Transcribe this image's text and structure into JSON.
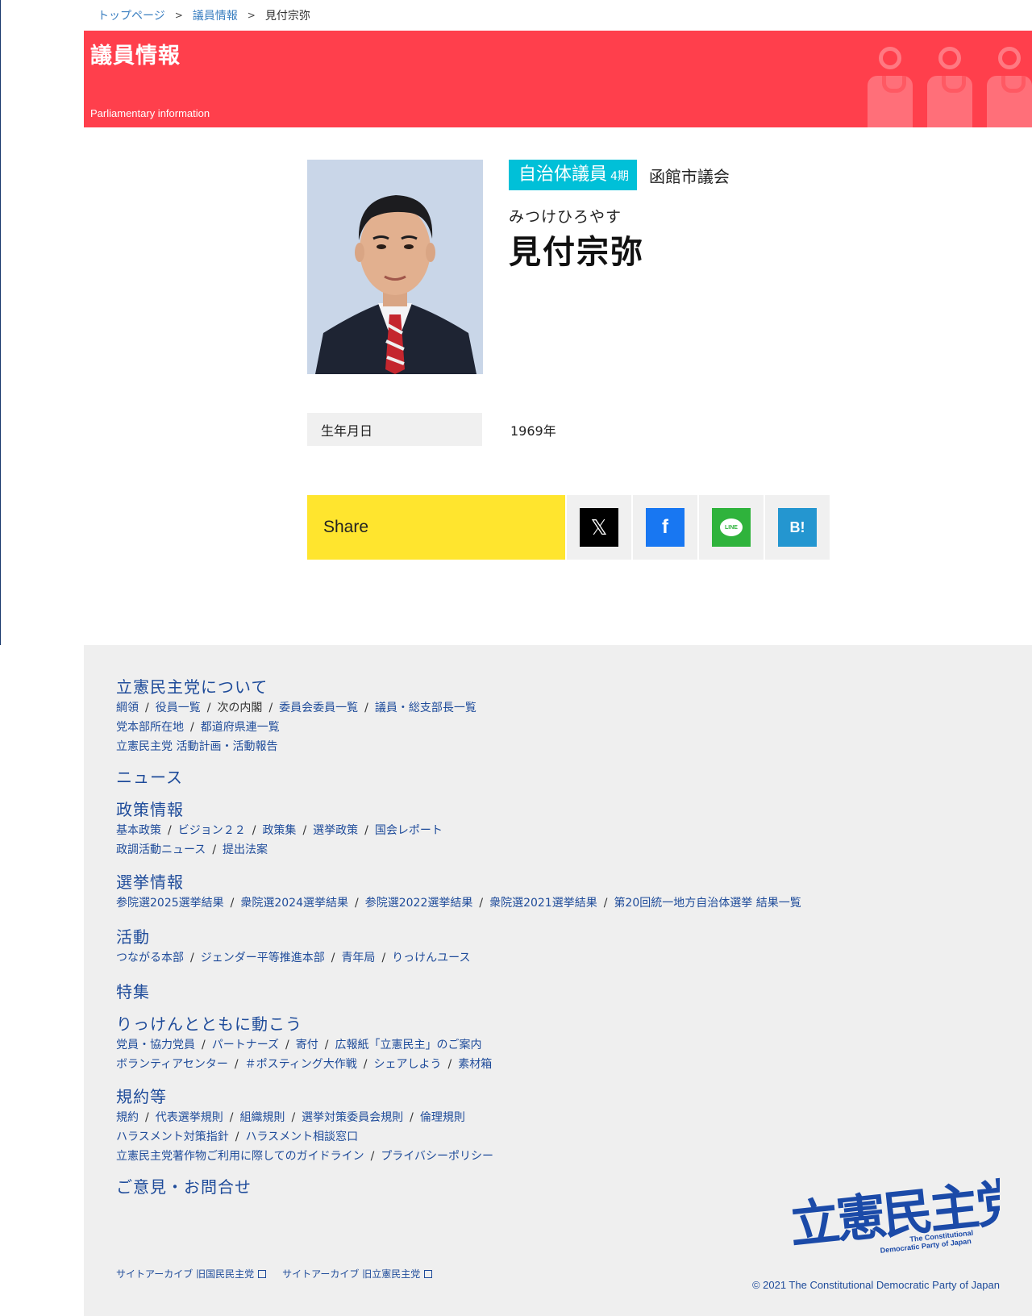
{
  "breadcrumb": [
    {
      "label": "トップページ"
    },
    {
      "label": "議員情報"
    },
    {
      "current": "見付宗弥"
    }
  ],
  "hero": {
    "title": "議員情報",
    "subtitle": "Parliamentary information"
  },
  "profile": {
    "badge_label": "自治体議員",
    "badge_term": "4期",
    "assembly": "函館市議会",
    "kana": "みつけひろやす",
    "name": "見付宗弥"
  },
  "info": {
    "birth_label": "生年月日",
    "birth_value": "1969年"
  },
  "share": {
    "label": "Share",
    "buttons": [
      "x-icon",
      "facebook-icon",
      "line-icon",
      "hatena-bookmark-icon"
    ],
    "x_glyph": "𝕏",
    "fb_glyph": "f",
    "line_glyph": "LINE",
    "hb_glyph": "B!"
  },
  "colors": {
    "hero": "#ff3f4c",
    "badge": "#00c0d8",
    "share": "#ffe52e",
    "footer_link": "#1e4b9a"
  },
  "footer": {
    "about": {
      "title": "立憲民主党について",
      "line1": [
        "綱領",
        "役員一覧",
        "次の内閣",
        "委員会委員一覧",
        "議員・総支部長一覧"
      ],
      "line2": [
        "党本部所在地",
        "都道府県連一覧"
      ],
      "line3": [
        "立憲民主党 活動計画・活動報告"
      ]
    },
    "news": {
      "title": "ニュース"
    },
    "policy": {
      "title": "政策情報",
      "line1": [
        "基本政策",
        "ビジョン２２",
        "政策集",
        "選挙政策",
        "国会レポート"
      ],
      "line2": [
        "政調活動ニュース",
        "提出法案"
      ]
    },
    "election": {
      "title": "選挙情報",
      "line1": [
        "参院選2025選挙結果",
        "衆院選2024選挙結果",
        "参院選2022選挙結果",
        "衆院選2021選挙結果",
        "第20回統一地方自治体選挙 結果一覧"
      ]
    },
    "activity": {
      "title": "活動",
      "line1": [
        "つながる本部",
        "ジェンダー平等推進本部",
        "青年局",
        "りっけんユース"
      ]
    },
    "feature": {
      "title": "特集"
    },
    "together": {
      "title": "りっけんとともに動こう",
      "line1": [
        "党員・協力党員",
        "パートナーズ",
        "寄付",
        "広報紙「立憲民主」のご案内"
      ],
      "line2": [
        "ボランティアセンター",
        "＃ポスティング大作戦",
        "シェアしよう",
        "素材箱"
      ]
    },
    "rules": {
      "title": "規約等",
      "line1": [
        "規約",
        "代表選挙規則",
        "組織規則",
        "選挙対策委員会規則",
        "倫理規則"
      ],
      "line2": [
        "ハラスメント対策指針",
        "ハラスメント相談窓口"
      ],
      "line3": [
        "立憲民主党著作物ご利用に際してのガイドライン",
        "プライバシーポリシー"
      ]
    },
    "contact": {
      "title": "ご意見・お問合せ"
    },
    "archive1": "サイトアーカイブ 旧国民民主党",
    "archive2": "サイトアーカイブ 旧立憲民主党",
    "logo_text": "立憲民主党",
    "logo_en1": "The Constitutional",
    "logo_en2": "Democratic Party of Japan",
    "copyright": "© 2021 The Constitutional Democratic Party of Japan"
  }
}
